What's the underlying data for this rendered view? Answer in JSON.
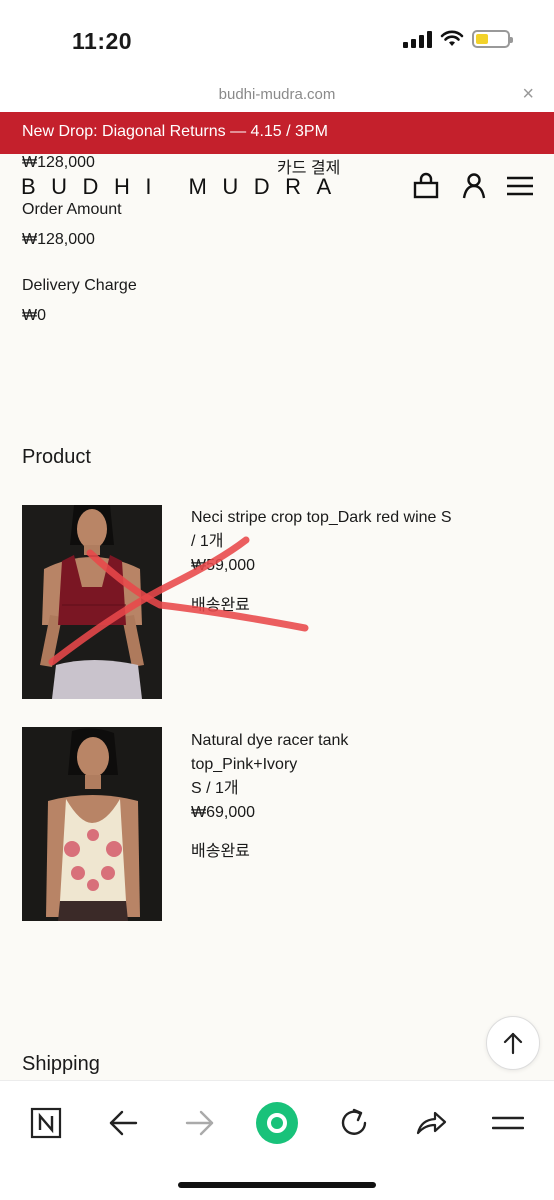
{
  "status_bar": {
    "time": "11:20"
  },
  "browser": {
    "url": "budhi-mudra.com",
    "close_glyph": "×"
  },
  "banner": {
    "text": "New Drop: Diagonal Returns — 4.15 / 3PM"
  },
  "header": {
    "overlay_amount": "₩128,000",
    "overlay_payment": "카드 결제",
    "logo": "BUDHI MUDRA",
    "icons": [
      "bag-icon",
      "user-icon",
      "menu-icon"
    ]
  },
  "order": {
    "order_amount_label": "Order Amount",
    "order_amount_value": "₩128,000",
    "delivery_label": "Delivery Charge",
    "delivery_value": "₩0"
  },
  "product_section": {
    "title": "Product",
    "items": [
      {
        "name_line1": "Neci stripe crop top_Dark red wine S",
        "name_line2": "/ 1개",
        "price": "₩59,000",
        "status": "배송완료"
      },
      {
        "name_line1": "Natural dye racer tank",
        "name_line2": "top_Pink+Ivory",
        "option": "S / 1개",
        "price": "₩69,000",
        "status": "배송완료"
      }
    ]
  },
  "shipping": {
    "title": "Shipping"
  },
  "bottom_bar": {
    "items": [
      "naver-icon",
      "back-arrow-icon",
      "forward-arrow-icon",
      "green-dot-icon",
      "reload-icon",
      "share-icon",
      "menu-icon"
    ]
  },
  "colors": {
    "banner": "#c4202c",
    "accent_green": "#19c27a",
    "scribble": "#e8484a"
  }
}
